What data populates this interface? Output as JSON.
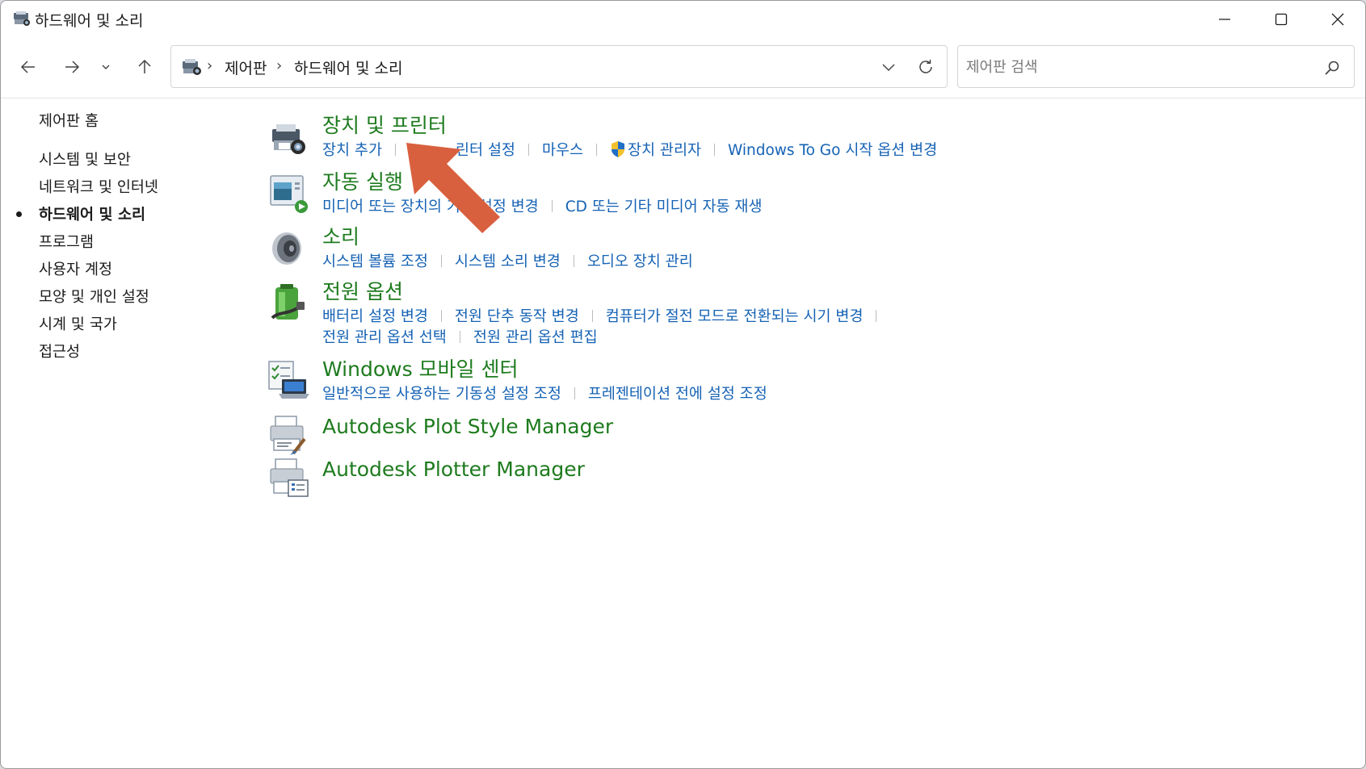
{
  "window": {
    "title": "하드웨어 및 소리"
  },
  "address": {
    "crumbs": [
      "제어판",
      "하드웨어 및 소리"
    ]
  },
  "search": {
    "placeholder": "제어판 검색"
  },
  "sidebar": {
    "home": "제어판 홈",
    "items": [
      {
        "label": "시스템 및 보안",
        "active": false
      },
      {
        "label": "네트워크 및 인터넷",
        "active": false
      },
      {
        "label": "하드웨어 및 소리",
        "active": true
      },
      {
        "label": "프로그램",
        "active": false
      },
      {
        "label": "사용자 계정",
        "active": false
      },
      {
        "label": "모양 및 개인 설정",
        "active": false
      },
      {
        "label": "시계 및 국가",
        "active": false
      },
      {
        "label": "접근성",
        "active": false
      }
    ]
  },
  "categories": [
    {
      "icon": "printer-camera-icon",
      "title": "장치 및 프린터",
      "links": [
        "장치 추가",
        "고급 프린터 설정",
        "마우스",
        "장치 관리자",
        "Windows To Go 시작 옵션 변경"
      ],
      "links_visible": [
        "장치 추가",
        "린터 설정",
        "마우스",
        "장치 관리자",
        "Windows To Go 시작 옵션 변경"
      ]
    },
    {
      "icon": "autoplay-icon",
      "title": "자동 실행",
      "links": [
        "미디어 또는 장치의 기본 설정 변경",
        "CD 또는 기타 미디어 자동 재생"
      ]
    },
    {
      "icon": "speaker-icon",
      "title": "소리",
      "links": [
        "시스템 볼륨 조정",
        "시스템 소리 변경",
        "오디오 장치 관리"
      ]
    },
    {
      "icon": "power-plug-icon",
      "title": "전원 옵션",
      "links_row1": [
        "배터리 설정 변경",
        "전원 단추 동작 변경",
        "컴퓨터가 절전 모드로 전환되는 시기 변경"
      ],
      "links_row2": [
        "전원 관리 옵션 선택",
        "전원 관리 옵션 편집"
      ]
    },
    {
      "icon": "mobility-center-icon",
      "title": "Windows 모바일 센터",
      "links": [
        "일반적으로 사용하는 기동성 설정 조정",
        "프레젠테이션 전에 설정 조정"
      ]
    },
    {
      "icon": "plot-style-icon",
      "title": "Autodesk Plot Style Manager",
      "links": []
    },
    {
      "icon": "plotter-icon",
      "title": "Autodesk Plotter Manager",
      "links": []
    }
  ],
  "colors": {
    "heading_green": "#1e7b1e",
    "link_blue": "#1562b4",
    "arrow": "#d9603f"
  }
}
